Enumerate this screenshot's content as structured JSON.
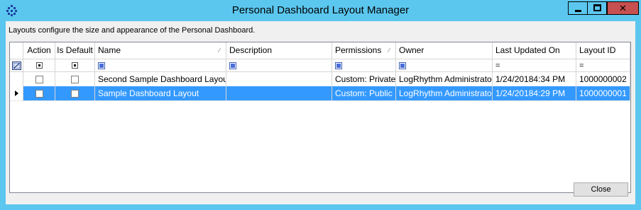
{
  "window": {
    "title": "Personal Dashboard Layout Manager",
    "icon": "app-grid-icon",
    "close_glyph": "✕"
  },
  "description": "Layouts configure the size and appearance of the Personal Dashboard.",
  "grid": {
    "columns": [
      {
        "key": "action",
        "label": "Action"
      },
      {
        "key": "is_default",
        "label": "Is Default"
      },
      {
        "key": "name",
        "label": "Name"
      },
      {
        "key": "description",
        "label": "Description"
      },
      {
        "key": "permissions",
        "label": "Permissions"
      },
      {
        "key": "owner",
        "label": "Owner"
      },
      {
        "key": "last_updated",
        "label": "Last Updated On"
      },
      {
        "key": "layout_id",
        "label": "Layout ID"
      }
    ],
    "filter_operators": {
      "last_updated": "=",
      "layout_id": "="
    },
    "rows": [
      {
        "action": false,
        "is_default": false,
        "name": "Second Sample Dashboard Layout",
        "description": "",
        "permissions": "Custom: Private",
        "owner": "LogRhythm Administrator",
        "last_updated": "1/24/20184:34 PM",
        "layout_id": "1000000002",
        "selected": false
      },
      {
        "action": false,
        "is_default": false,
        "name": "Sample Dashboard Layout",
        "description": "",
        "permissions": "Custom: Public",
        "owner": "LogRhythm Administrator",
        "last_updated": "1/24/20184:29 PM",
        "layout_id": "1000000001",
        "selected": true
      }
    ]
  },
  "buttons": {
    "close": "Close"
  },
  "colors": {
    "titlebar": "#5bc7ef",
    "selection": "#3399ff",
    "close_button": "#c75050"
  }
}
